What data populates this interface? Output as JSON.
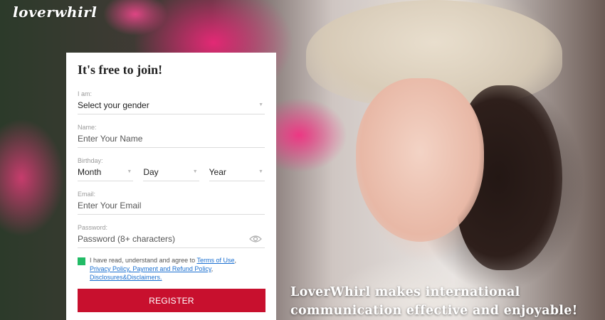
{
  "brand": {
    "logo": "loverwhirl"
  },
  "form": {
    "title": "It's free to join!",
    "gender": {
      "label": "I am:",
      "value": "Select your gender"
    },
    "name": {
      "label": "Name:",
      "placeholder": "Enter Your Name"
    },
    "birthday": {
      "label": "Birthday:",
      "month": "Month",
      "day": "Day",
      "year": "Year"
    },
    "email": {
      "label": "Email:",
      "placeholder": "Enter Your Email"
    },
    "password": {
      "label": "Password:",
      "placeholder": "Password (8+ characters)"
    },
    "consent": {
      "prefix": "I have read, understand and agree to ",
      "terms": "Terms of Use",
      "sep1": ",",
      "privacy": "Privacy Policy, Payment and Refund Policy",
      "sep2": ",",
      "disclosures": "Disclosures&Disclaimers."
    },
    "register_label": "REGISTER"
  },
  "tagline": {
    "line1": "LoverWhirl makes international",
    "line2": "communication effective and enjoyable!"
  },
  "colors": {
    "accent": "#c8102e",
    "checkbox": "#22bb66",
    "link": "#1a6fd0"
  }
}
